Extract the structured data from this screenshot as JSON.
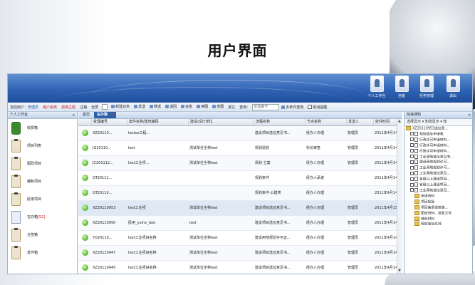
{
  "slide": {
    "title": "用户界面"
  },
  "header": {
    "buttons": [
      {
        "label": "个人工作台",
        "icon": "user-icon"
      },
      {
        "label": "自客",
        "icon": "client-icon"
      },
      {
        "label": "任务管理",
        "icon": "task-icon"
      },
      {
        "label": "退出",
        "icon": "exit-icon"
      }
    ]
  },
  "toolbar": {
    "current_user_label": "当前用户：",
    "current_user": "管理员",
    "items_red": [
      "用户系统",
      "更换主题"
    ],
    "items": [
      "注销",
      "全屏"
    ],
    "actions": [
      "新建业务",
      "发送",
      "移送",
      "退回",
      "会签",
      "续图",
      "查图"
    ],
    "other_label": "其它",
    "search_label": "查询：",
    "search_placeholder": "受理编号",
    "multi_condition": "多条件查询",
    "cancel_reminder": "取消提醒"
  },
  "left_panel": {
    "title": "个人工作台",
    "items": [
      {
        "label": "收费箱",
        "count": ""
      },
      {
        "label": "项目列表",
        "count": ""
      },
      {
        "label": "图政项目",
        "count": ""
      },
      {
        "label": "编制项目",
        "count": ""
      },
      {
        "label": "民用项目",
        "count": ""
      },
      {
        "label": "在办箱",
        "count": "[52]"
      },
      {
        "label": "合签箱",
        "count": ""
      },
      {
        "label": "发件箱",
        "count": ""
      }
    ]
  },
  "tabs": [
    {
      "label": "首页"
    },
    {
      "label": "在办箱"
    }
  ],
  "table": {
    "columns": [
      "受理编号",
      "案件名称/建筑编码",
      "建设/设计单位",
      "流程名称",
      "节点名称",
      "发送人",
      "收件时间"
    ],
    "rows": [
      {
        "id": "XZ20110...",
        "name": "testxx工程...",
        "unit": "",
        "flow": "建设项目选址意见书...",
        "node": "经办人办理",
        "sender": "管理员",
        "time": "2011年4月14日"
      },
      {
        "id": "JG20110...",
        "name": "test",
        "unit": "测试单位全称test",
        "flow": "规划验收",
        "node": "科长审查",
        "sender": "管理员",
        "time": "2011年4月14日"
      },
      {
        "id": "JC201112...",
        "name": "test工业项...",
        "unit": "测试单位全称test",
        "flow": "规划·立案",
        "node": "经办人办理",
        "sender": "管理员",
        "time": "2011年4月14日"
      },
      {
        "id": "GT20111...",
        "name": "",
        "unit": "",
        "flow": "规划条件",
        "node": "经办人承诺",
        "sender": "",
        "time": "2011年4月14日"
      },
      {
        "id": "GT20110...",
        "name": "",
        "unit": "",
        "flow": "规划条件·公建类",
        "node": "经办人办理",
        "sender": "",
        "time": "2011年4月14日"
      },
      {
        "id": "XZ20110953",
        "name": "test工业项",
        "unit": "测试单位全称test",
        "flow": "建设项目选址意见书...",
        "node": "经办人办理",
        "sender": "管理员",
        "time": "2011年4月15日"
      },
      {
        "id": "XZ20110950",
        "name": "民用_yuinx_test",
        "unit": "test",
        "flow": "建设项目选址意见书...",
        "node": "经办人办理",
        "sender": "管理员",
        "time": "2011年4月14日"
      },
      {
        "id": "YD20110...",
        "name": "test工业项目名称",
        "unit": "测试单位全称test",
        "flow": "建设用地规划许可证...",
        "node": "经办人办理",
        "sender": "管理员",
        "time": "2011年4月14日"
      },
      {
        "id": "XZ20110947",
        "name": "test工业项目名称",
        "unit": "测试单位全称test",
        "flow": "建设项目选址意见书...",
        "node": "经办人办理",
        "sender": "管理员",
        "time": "2011年4月14日"
      },
      {
        "id": "XZ20110945",
        "name": "test工业项目名称",
        "unit": "测试单位全称test",
        "flow": "建设项目选址意见书...",
        "node": "经办人办理",
        "sender": "管理员",
        "time": "2011年4月14日"
      }
    ]
  },
  "right_panel": {
    "title": "快递通知",
    "tools": "选择显示 ▾   知道显示 ▾   知",
    "tree": [
      {
        "label": "XZ20110953选址意...",
        "level": 0,
        "type": "folder"
      },
      {
        "label": "规划选址申请表",
        "level": 1,
        "type": "doc"
      },
      {
        "label": "行政许可申请材料...",
        "level": 1,
        "type": "doc"
      },
      {
        "label": "行政许可申请材料...",
        "level": 1,
        "type": "doc"
      },
      {
        "label": "行政许可申请材料...",
        "level": 1,
        "type": "doc"
      },
      {
        "label": "工业用地选址意见书...",
        "level": 1,
        "type": "doc"
      },
      {
        "label": "建设用地规划许可...",
        "level": 1,
        "type": "doc"
      },
      {
        "label": "工业用地规划许可...",
        "level": 1,
        "type": "doc"
      },
      {
        "label": "工业用地选址意见...",
        "level": 1,
        "type": "doc"
      },
      {
        "label": "省级以上建设项目...",
        "level": 1,
        "type": "doc"
      },
      {
        "label": "省级以上建设项目...",
        "level": 1,
        "type": "doc"
      },
      {
        "label": "工业用地选址意见...",
        "level": 1,
        "type": "doc"
      },
      {
        "label": "申请资料",
        "level": 2,
        "type": "folder"
      },
      {
        "label": "项目批复",
        "level": 2,
        "type": "folder"
      },
      {
        "label": "项目备案或核准...",
        "level": 2,
        "type": "folder"
      },
      {
        "label": "图纸资料、批复文件",
        "level": 2,
        "type": "folder"
      },
      {
        "label": "其他材料",
        "level": 2,
        "type": "folder"
      },
      {
        "label": "规划选址红线",
        "level": 2,
        "type": "folder"
      }
    ]
  },
  "colors": {
    "banner": "#2f63b4",
    "active_tab": "#2f5fa8",
    "status_green": "#56b62c",
    "highlight_red": "#c81e1e"
  }
}
